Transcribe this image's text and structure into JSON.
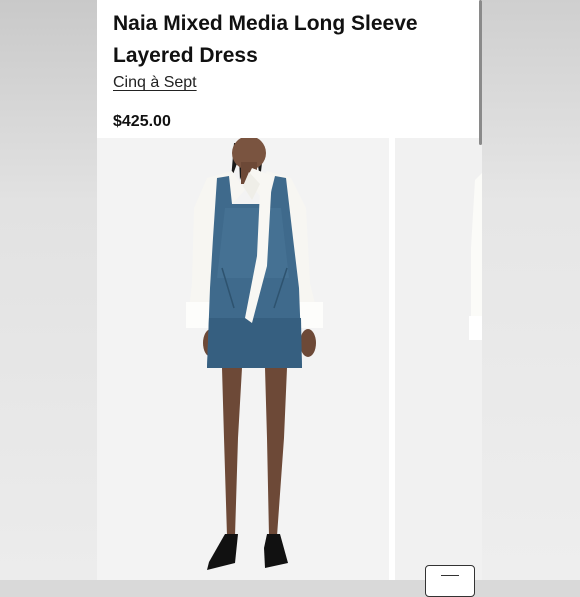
{
  "product": {
    "title": "Naia Mixed Media Long Sleeve Layered Dress",
    "brand": "Cinq à Sept",
    "price": "$425.00"
  },
  "images": [
    {
      "name": "main-product-photo",
      "description": "model wearing denim pinafore dress over white tie-neck blouse"
    },
    {
      "name": "next-product-photo",
      "description": "partially visible second photo"
    }
  ],
  "colors": {
    "panel": "#ffffff",
    "text": "#111111",
    "denim": "#3f6a8c",
    "blouse": "#f7f6f2",
    "shoes": "#111111"
  },
  "icons": [
    "more-photos-icon"
  ]
}
